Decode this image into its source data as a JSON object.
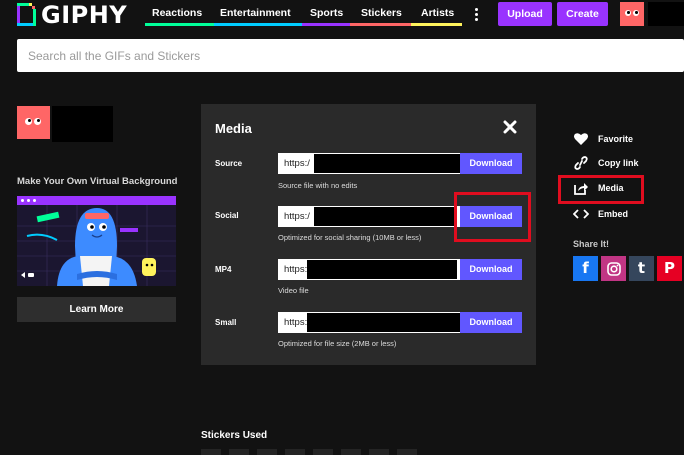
{
  "header": {
    "logo_text": "GIPHY",
    "nav": [
      {
        "label": "Reactions",
        "color": "#00ff99"
      },
      {
        "label": "Entertainment",
        "color": "#00ccff"
      },
      {
        "label": "Sports",
        "color": "#9933ff"
      },
      {
        "label": "Stickers",
        "color": "#ff6666"
      },
      {
        "label": "Artists",
        "color": "#fff35c"
      }
    ],
    "more_icon": "kebab-icon",
    "upload_label": "Upload",
    "create_label": "Create"
  },
  "search": {
    "placeholder": "Search all the GIFs and Stickers"
  },
  "left": {
    "promo_title": "Make Your Own Virtual Background",
    "learn_more_label": "Learn More"
  },
  "modal": {
    "title": "Media",
    "close_icon": "close-icon",
    "rows": [
      {
        "label": "Source",
        "url_prefix": "https:/",
        "download_label": "Download",
        "description": "Source file with no edits"
      },
      {
        "label": "Social",
        "url_prefix": "https:/",
        "download_label": "Download",
        "description": "Optimized for social sharing (10MB or less)"
      },
      {
        "label": "MP4",
        "url_prefix": "https:",
        "download_label": "Download",
        "description": "Video file"
      },
      {
        "label": "Small",
        "url_prefix": "https:",
        "download_label": "Download",
        "description": "Optimized for file size (2MB or less)"
      }
    ]
  },
  "actions": [
    {
      "label": "Favorite",
      "icon": "heart-icon"
    },
    {
      "label": "Copy link",
      "icon": "link-icon"
    },
    {
      "label": "Media",
      "icon": "share-arrow-icon"
    },
    {
      "label": "Embed",
      "icon": "code-icon"
    }
  ],
  "share": {
    "title": "Share It!",
    "networks": [
      {
        "glyph": "f",
        "color": "#1877f2",
        "icon": "facebook-icon"
      },
      {
        "glyph": "◎",
        "color": "#c13584",
        "icon": "instagram-icon"
      },
      {
        "glyph": "t",
        "color": "#35465c",
        "icon": "tumblr-icon"
      },
      {
        "glyph": "P",
        "color": "#e60023",
        "icon": "pinterest-icon"
      }
    ]
  },
  "stickers_used": "Stickers Used",
  "colors": {
    "accent": "#9933ff",
    "download": "#6157ff",
    "highlight": "#e00d1f",
    "avatar": "#ff6666"
  }
}
